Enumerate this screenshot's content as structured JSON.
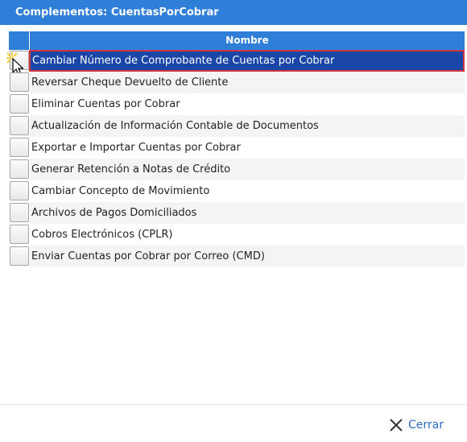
{
  "window": {
    "title": "Complementos: CuentasPorCobrar"
  },
  "grid": {
    "column_header": "Nombre",
    "rows": [
      {
        "label": "Cambiar Número de Comprobante de Cuentas por Cobrar",
        "selected": true
      },
      {
        "label": "Reversar Cheque Devuelto de Cliente",
        "selected": false
      },
      {
        "label": "Eliminar Cuentas por Cobrar",
        "selected": false
      },
      {
        "label": "Actualización de Información Contable de Documentos",
        "selected": false
      },
      {
        "label": "Exportar e Importar Cuentas por Cobrar",
        "selected": false
      },
      {
        "label": "Generar Retención a Notas de Crédito",
        "selected": false
      },
      {
        "label": "Cambiar Concepto de Movimiento",
        "selected": false
      },
      {
        "label": "Archivos de Pagos Domiciliados",
        "selected": false
      },
      {
        "label": "Cobros Electrónicos (CPLR)",
        "selected": false
      },
      {
        "label": "Enviar Cuentas por Cobrar por Correo (CMD)",
        "selected": false
      }
    ]
  },
  "footer": {
    "close_label": "Cerrar",
    "close_icon": "close-x-icon"
  },
  "colors": {
    "accent": "#2f7ed8",
    "selection": "#1a46a8",
    "selection_border": "#d4353a",
    "link": "#2f6bc0"
  }
}
